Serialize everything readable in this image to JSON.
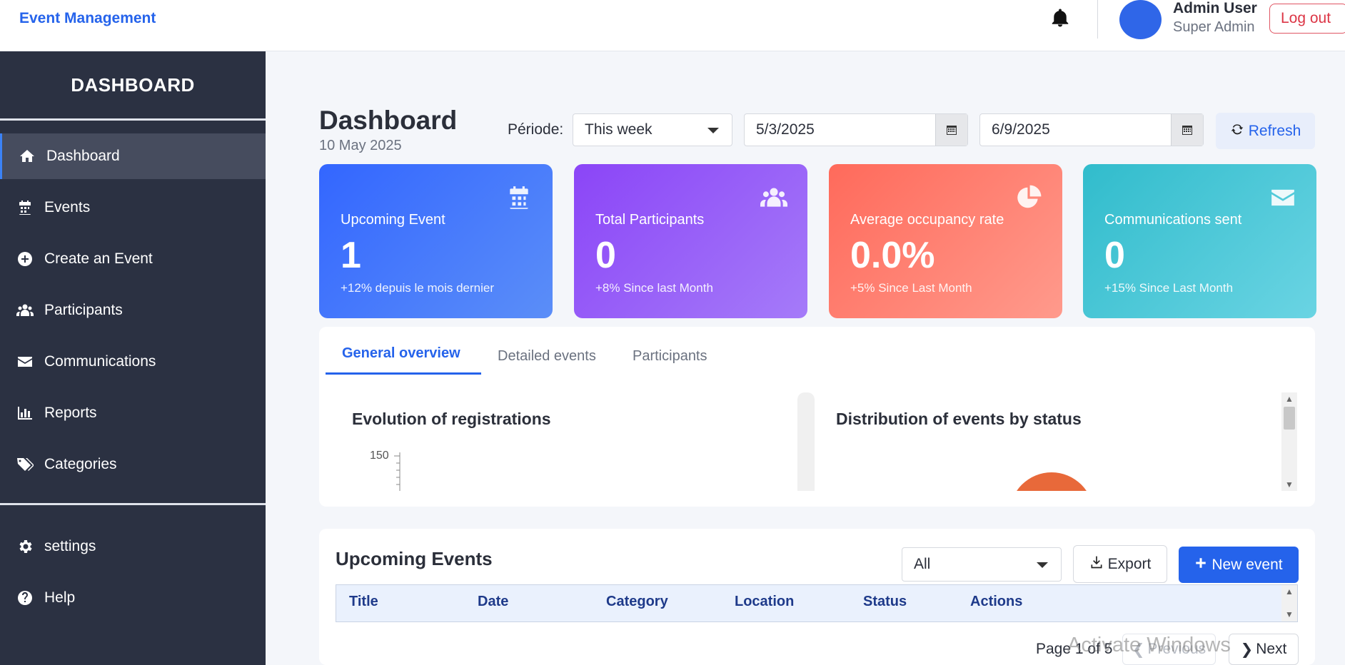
{
  "app": {
    "brand": "Event Management"
  },
  "user": {
    "name": "Admin User",
    "role": "Super Admin",
    "logout_label": "Log out"
  },
  "sidebar": {
    "title": "DASHBOARD",
    "items": [
      {
        "label": "Dashboard",
        "icon": "home-icon",
        "active": true
      },
      {
        "label": "Events",
        "icon": "calendar-icon"
      },
      {
        "label": "Create an Event",
        "icon": "plus-circle-icon"
      },
      {
        "label": "Participants",
        "icon": "users-icon"
      },
      {
        "label": "Communications",
        "icon": "envelope-icon"
      },
      {
        "label": "Reports",
        "icon": "bar-chart-icon"
      },
      {
        "label": "Categories",
        "icon": "tags-icon"
      }
    ],
    "bottom_items": [
      {
        "label": "settings",
        "icon": "gear-icon"
      },
      {
        "label": "Help",
        "icon": "question-circle-icon"
      }
    ]
  },
  "header": {
    "title": "Dashboard",
    "date": "10 May 2025",
    "periode_label": "Période:",
    "periode_value": "This week",
    "start_date": "5/3/2025",
    "end_date": "6/9/2025",
    "refresh_label": "Refresh"
  },
  "stats": [
    {
      "label": "Upcoming Event",
      "value": "1",
      "sub": "+12% depuis le mois dernier",
      "icon": "calendar-icon",
      "color_from": "#3366ff",
      "color_to": "#5b8ef8"
    },
    {
      "label": "Total Participants",
      "value": "0",
      "sub": "+8% Since last Month",
      "icon": "users-icon",
      "color_from": "#8b45f7",
      "color_to": "#a57bf9"
    },
    {
      "label": "Average occupancy rate",
      "value": "0.0%",
      "sub": "+5% Since Last Month",
      "icon": "pie-chart-icon",
      "color_from": "#ff6a5b",
      "color_to": "#ff9a8c"
    },
    {
      "label": "Communications sent",
      "value": "0",
      "sub": "+15% Since Last Month",
      "icon": "envelope-icon",
      "color_from": "#31bccc",
      "color_to": "#6ad4e3"
    }
  ],
  "tabs": [
    {
      "label": "General overview",
      "active": true
    },
    {
      "label": "Detailed events"
    },
    {
      "label": "Participants"
    }
  ],
  "overview": {
    "registrations_title": "Evolution of registrations",
    "y_tick_top": "150",
    "distribution_title": "Distribution of events by status"
  },
  "upcoming": {
    "title": "Upcoming Events",
    "filter_value": "All",
    "export_label": "Export",
    "new_label": "New event",
    "columns": [
      "Title",
      "Date",
      "Category",
      "Location",
      "Status",
      "Actions"
    ],
    "pager": "Page 1 of 5",
    "prev_label": "Previous",
    "next_label": "Next"
  },
  "os": {
    "watermark": "Activate Windows"
  },
  "colors": {
    "accent": "#2563eb",
    "sidebar": "#2b3142",
    "danger": "#dc3545"
  }
}
